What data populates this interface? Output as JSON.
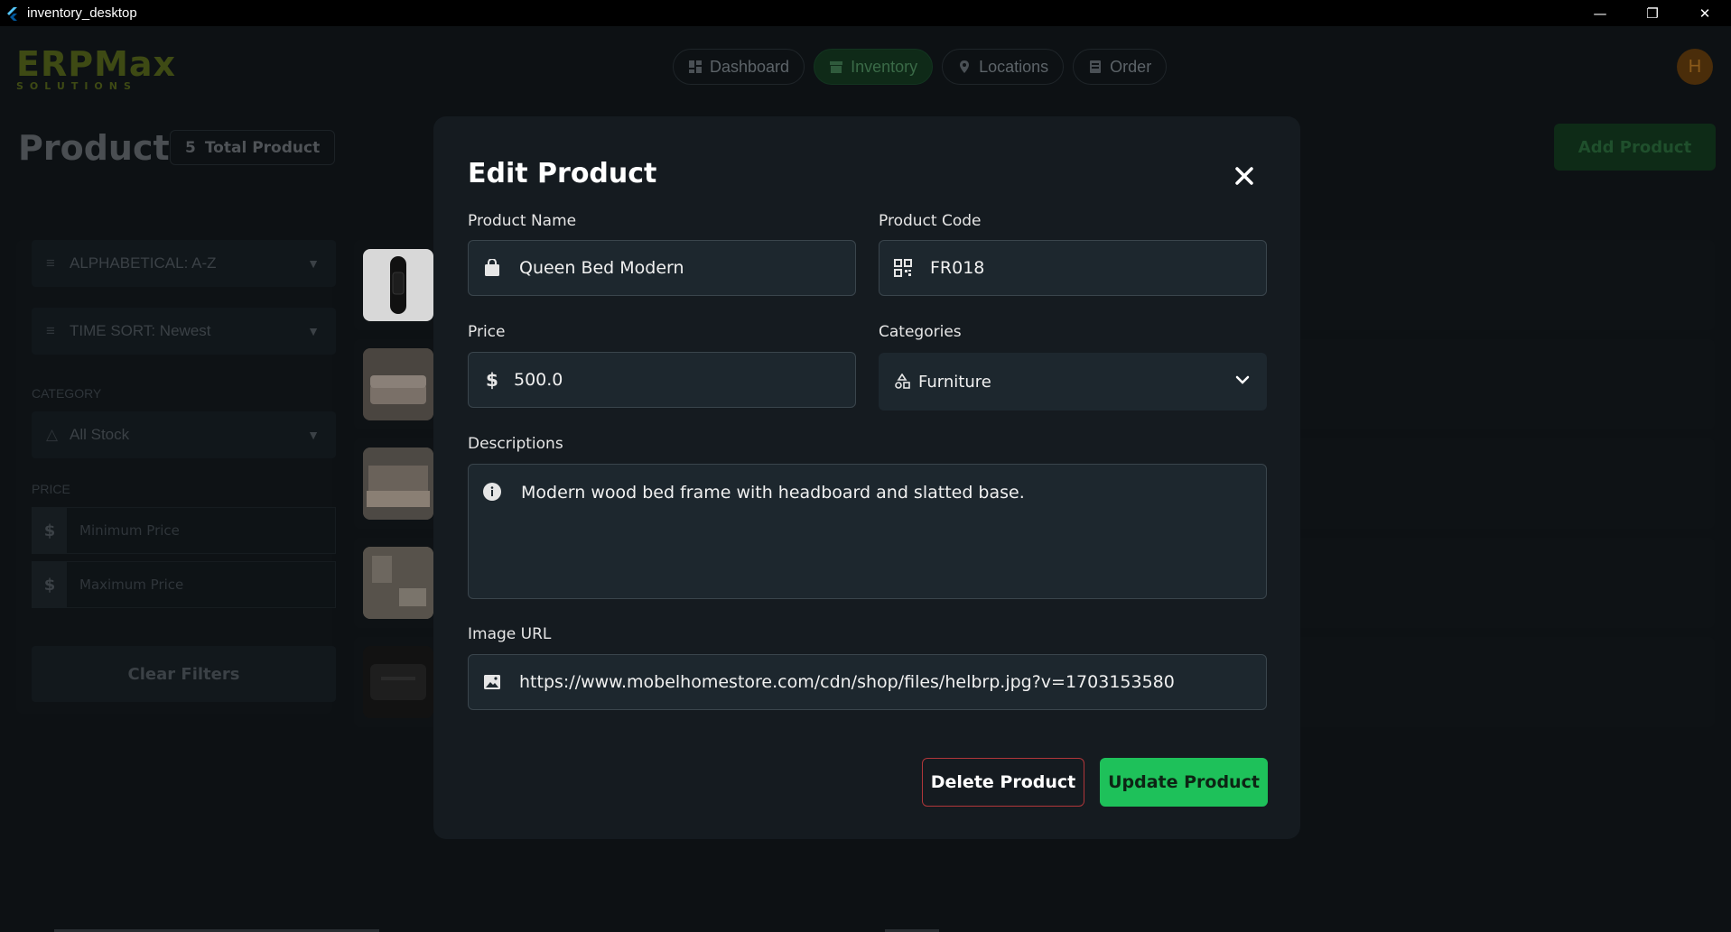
{
  "window": {
    "title": "inventory_desktop",
    "controls": [
      "minimize",
      "restore",
      "close"
    ]
  },
  "brand": {
    "logo_main": "ERPMax",
    "logo_sub": "SOLUTIONS"
  },
  "nav": {
    "items": [
      {
        "label": "Dashboard",
        "icon": "dashboard-icon"
      },
      {
        "label": "Inventory",
        "icon": "inventory-icon"
      },
      {
        "label": "Locations",
        "icon": "location-pin-icon"
      },
      {
        "label": "Order",
        "icon": "order-icon"
      }
    ],
    "active": "Inventory"
  },
  "user": {
    "avatar_initial": "H"
  },
  "header": {
    "title": "Product",
    "count": "5",
    "count_label": "Total Product",
    "add_button": "Add Product"
  },
  "filters": {
    "sort_alpha": "ALPHABETICAL: A-Z",
    "sort_time": "TIME SORT: Newest",
    "category_label": "CATEGORY",
    "category_value": "All Stock",
    "price_label": "PRICE",
    "currency_symbol": "$",
    "min_placeholder": "Minimum Price",
    "max_placeholder": "Maximum Price",
    "clear_button": "Clear Filters"
  },
  "products_list": {
    "rows": 5
  },
  "modal": {
    "title": "Edit Product",
    "product_name_label": "Product Name",
    "product_name_value": "Queen Bed Modern",
    "product_code_label": "Product Code",
    "product_code_value": "FR018",
    "price_label": "Price",
    "price_currency": "$",
    "price_value": "500.0",
    "categories_label": "Categories",
    "categories_value": "Furniture",
    "descriptions_label": "Descriptions",
    "descriptions_value": "Modern wood bed frame with headboard and slatted base.",
    "image_url_label": "Image URL",
    "image_url_value": "https://www.mobelhomestore.com/cdn/shop/files/helbrp.jpg?v=1703153580",
    "delete_button": "Delete Product",
    "update_button": "Update Product"
  },
  "colors": {
    "accent_green": "#1ec15a",
    "danger_red": "#b0363a",
    "modal_bg": "#151b20",
    "field_bg": "#1d272e"
  }
}
